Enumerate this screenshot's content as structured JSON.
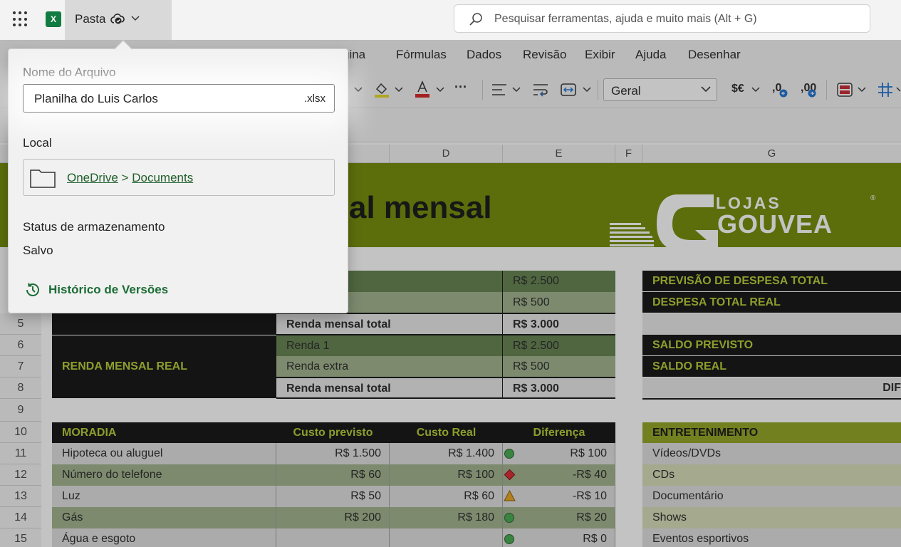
{
  "titlebar": {
    "app_icon": "excel-icon",
    "app_icon_letter": "X",
    "workbook_location": "Pasta",
    "search_placeholder": "Pesquisar ferramentas, ajuda e muito mais (Alt + G)"
  },
  "menu": {
    "items": [
      "gina",
      "Fórmulas",
      "Dados",
      "Revisão",
      "Exibir",
      "Ajuda",
      "Desenhar"
    ]
  },
  "toolbar": {
    "number_format": "Geral",
    "currency_label": "$€",
    "dec_inc": ",0",
    "dec_dec": ",00",
    "more": "···"
  },
  "columns": [
    "D",
    "E",
    "F",
    "G"
  ],
  "rows": [
    "5",
    "6",
    "7",
    "8",
    "9",
    "10",
    "11",
    "12",
    "13",
    "14",
    "15"
  ],
  "banner": {
    "title_fragment": "al mensal",
    "logo_top": "LOJAS",
    "logo_bottom": "GOUVEA",
    "logo_reg": "®"
  },
  "income": {
    "rows_top": [
      "R$ 2.500",
      "R$ 500"
    ],
    "planned_total_label": "Renda mensal total",
    "planned_total_value": "R$ 3.000",
    "real_label": "RENDA MENSAL REAL",
    "real_rows": [
      {
        "label": "Renda 1",
        "value": "R$ 2.500"
      },
      {
        "label": "Renda extra",
        "value": "R$ 500"
      },
      {
        "label": "Renda mensal total",
        "value": "R$ 3.000"
      }
    ]
  },
  "summary": {
    "items": [
      "PREVISÃO DE DESPESA TOTAL",
      "DESPESA TOTAL REAL",
      "SALDO PREVISTO",
      "SALDO REAL"
    ],
    "diff_fragment": "DIF"
  },
  "moradia": {
    "headers": [
      "MORADIA",
      "Custo previsto",
      "Custo Real",
      "Diferença"
    ],
    "rows": [
      {
        "item": "Hipoteca ou aluguel",
        "previsto": "R$ 1.500",
        "real": "R$ 1.400",
        "status": "good",
        "diff": "R$ 100"
      },
      {
        "item": "Número do telefone",
        "previsto": "R$ 60",
        "real": "R$ 100",
        "status": "bad",
        "diff": "-R$ 40"
      },
      {
        "item": "Luz",
        "previsto": "R$ 50",
        "real": "R$ 60",
        "status": "warn",
        "diff": "-R$ 10"
      },
      {
        "item": "Gás",
        "previsto": "R$ 200",
        "real": "R$ 180",
        "status": "good",
        "diff": "R$ 20"
      },
      {
        "item": "Água e esgoto",
        "previsto": "",
        "real": "",
        "status": "good",
        "diff": "R$ 0"
      }
    ]
  },
  "entretenimento": {
    "header": "ENTRETENIMENTO",
    "items": [
      "Vídeos/DVDs",
      "CDs",
      "Documentário",
      "Shows",
      "Eventos esportivos"
    ]
  },
  "panel": {
    "filename_label": "Nome do Arquivo",
    "filename_value": "Planilha do Luis Carlos",
    "filename_ext": ".xlsx",
    "location_label": "Local",
    "location_root": "OneDrive",
    "location_sep": ">",
    "location_folder": "Documents",
    "status_label": "Status de armazenamento",
    "status_value": "Salvo",
    "history_link": "Histórico de Versões"
  },
  "colors": {
    "banner_green": "#718a02",
    "accent_text": "#b6cc2f",
    "excel_green": "#107c41",
    "link_green": "#1c6d36"
  }
}
